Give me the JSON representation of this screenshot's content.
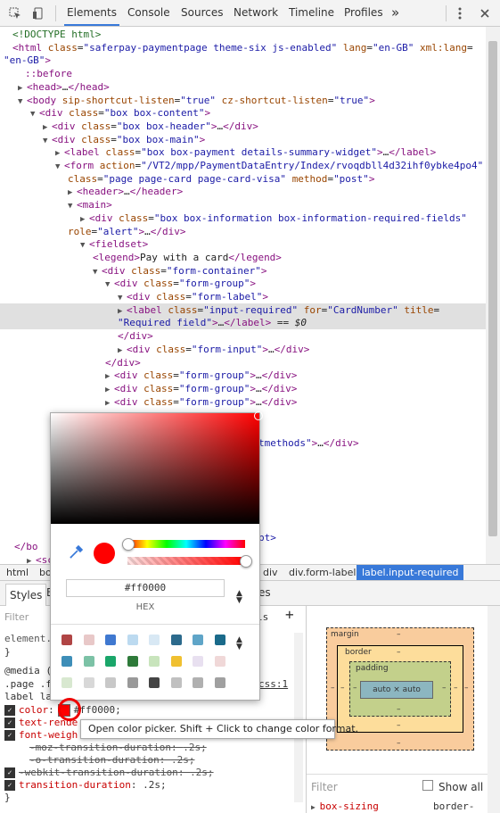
{
  "toolbar": {
    "tabs": [
      "Elements",
      "Console",
      "Sources",
      "Network",
      "Timeline",
      "Profiles"
    ],
    "more_label": "»"
  },
  "dom": [
    {
      "html": "<span class='cmt'>&lt;!DOCTYPE html&gt;</span>"
    },
    {
      "html": "<span class='tag'>&lt;html</span> <span class='attr'>class</span>=<span class='val'>\"saferpay-paymentpage theme-six js-enabled\"</span> <span class='attr'>lang</span>=<span class='val'>\"en-GB\"</span> <span class='attr'>xml:lang</span>="
    },
    {
      "html": "<span class='val'>\"en-GB\"</span><span class='tag'>&gt;</span>"
    },
    {
      "html": "<span class='pseudo'>::before</span>"
    },
    {
      "html": "<span class='tri'>▶</span><span class='tag'>&lt;head&gt;</span>…<span class='tag'>&lt;/head&gt;</span>"
    },
    {
      "html": "<span class='tri'>▼</span><span class='tag'>&lt;body</span> <span class='attr'>sip-shortcut-listen</span>=<span class='val'>\"true\"</span> <span class='attr'>cz-shortcut-listen</span>=<span class='val'>\"true\"</span><span class='tag'>&gt;</span>"
    },
    {
      "html": "<span class='tri'>▼</span><span class='tag'>&lt;div</span> <span class='attr'>class</span>=<span class='val'>\"box box-content\"</span><span class='tag'>&gt;</span>"
    },
    {
      "html": "<span class='tri'>▶</span><span class='tag'>&lt;div</span> <span class='attr'>class</span>=<span class='val'>\"box box-header\"</span><span class='tag'>&gt;</span>…<span class='tag'>&lt;/div&gt;</span>"
    },
    {
      "html": "<span class='tri'>▼</span><span class='tag'>&lt;div</span> <span class='attr'>class</span>=<span class='val'>\"box box-main\"</span><span class='tag'>&gt;</span>"
    },
    {
      "html": "<span class='tri'>▶</span><span class='tag'>&lt;label</span> <span class='attr'>class</span>=<span class='val'>\"box box-payment details-summary-widget\"</span><span class='tag'>&gt;</span>…<span class='tag'>&lt;/label&gt;</span>"
    },
    {
      "html": "<span class='tri'>▼</span><span class='tag'>&lt;form</span> <span class='attr'>action</span>=<span class='val'>\"/VT2/mpp/PaymentDataEntry/Index/rvoqdbll4d32ihf0ybke4po4\"</span>"
    },
    {
      "html": "<span class='attr'>class</span>=<span class='val'>\"page page-card page-card-visa\"</span> <span class='attr'>method</span>=<span class='val'>\"post\"</span><span class='tag'>&gt;</span>"
    },
    {
      "html": "<span class='tri'>▶</span><span class='tag'>&lt;header&gt;</span>…<span class='tag'>&lt;/header&gt;</span>"
    },
    {
      "html": "<span class='tri'>▼</span><span class='tag'>&lt;main&gt;</span>"
    },
    {
      "html": "<span class='tri'>▶</span><span class='tag'>&lt;div</span> <span class='attr'>class</span>=<span class='val'>\"box box-information box-information-required-fields\"</span>"
    },
    {
      "html": "<span class='attr'>role</span>=<span class='val'>\"alert\"</span><span class='tag'>&gt;</span>…<span class='tag'>&lt;/div&gt;</span>"
    },
    {
      "html": "<span class='tri'>▼</span><span class='tag'>&lt;fieldset&gt;</span>"
    },
    {
      "html": "<span class='tag'>&lt;legend&gt;</span>Pay with a card<span class='tag'>&lt;/legend&gt;</span>"
    },
    {
      "html": "<span class='tri'>▼</span><span class='tag'>&lt;div</span> <span class='attr'>class</span>=<span class='val'>\"form-container\"</span><span class='tag'>&gt;</span>"
    },
    {
      "html": "<span class='tri'>▼</span><span class='tag'>&lt;div</span> <span class='attr'>class</span>=<span class='val'>\"form-group\"</span><span class='tag'>&gt;</span>"
    },
    {
      "html": "<span class='tri'>▼</span><span class='tag'>&lt;div</span> <span class='attr'>class</span>=<span class='val'>\"form-label\"</span><span class='tag'>&gt;</span>"
    },
    {
      "html": "<span class='tri'>▶</span><span class='tag'>&lt;label</span> <span class='attr'>class</span>=<span class='val'>\"input-required\"</span> <span class='attr'>for</span>=<span class='val'>\"CardNumber\"</span> <span class='attr'>title</span>="
    },
    {
      "html": "<span class='val'>\"Required field\"</span><span class='tag'>&gt;</span>…<span class='tag'>&lt;/label&gt;</span> == <i>$0</i>"
    },
    {
      "html": "<span class='tag'>&lt;/div&gt;</span>"
    },
    {
      "html": "<span class='tri'>▶</span><span class='tag'>&lt;div</span> <span class='attr'>class</span>=<span class='val'>\"form-input\"</span><span class='tag'>&gt;</span>…<span class='tag'>&lt;/div&gt;</span>"
    },
    {
      "html": "<span class='tag'>&lt;/div&gt;</span>"
    },
    {
      "html": "<span class='tri'>▶</span><span class='tag'>&lt;div</span> <span class='attr'>class</span>=<span class='val'>\"form-group\"</span><span class='tag'>&gt;</span>…<span class='tag'>&lt;/div&gt;</span>"
    },
    {
      "html": "<span class='tri'>▶</span><span class='tag'>&lt;div</span> <span class='attr'>class</span>=<span class='val'>\"form-group\"</span><span class='tag'>&gt;</span>…<span class='tag'>&lt;/div&gt;</span>"
    },
    {
      "html": "<span class='tri'>▶</span><span class='tag'>&lt;div</span> <span class='attr'>class</span>=<span class='val'>\"form-group\"</span><span class='tag'>&gt;</span>…<span class='tag'>&lt;/div&gt;</span>"
    }
  ],
  "dom_partial": [
    {
      "html": "<span class='val'>tmethods\"</span><span class='tag'>&gt;</span>…<span class='tag'>&lt;/div&gt;</span>"
    },
    {
      "html": "<span class='val'>pt&gt;</span>"
    }
  ],
  "breadcrumbs": [
    "html",
    "bo",
    "div",
    "div.form-label",
    "label.input-required"
  ],
  "styles_tabs": [
    "Styles",
    "E"
  ],
  "styles_tab_partial": "es",
  "styles_filter_placeholder": "Filter",
  "styles_filter_suffix": "ls",
  "styles_lines": [
    {
      "text": "element.",
      "cls": ""
    },
    {
      "text": "}",
      "cls": ""
    },
    {
      "text": "@media (",
      "cls": ""
    },
    {
      "text": ".page .f",
      "cls": ""
    },
    {
      "text": "label la",
      "cls": ""
    }
  ],
  "css_link": "css:1",
  "decls": {
    "color_prop": "color",
    "color_value": "#ff0000;",
    "text_prop": "text-rende",
    "font_prop": "font-weigh",
    "moz_prop": "-moz-transition-duration",
    "moz_val": ".2s;",
    "o_prop": "-o-transition-duration",
    "o_val": ".2s;",
    "webkit_prop": "-webkit-transition-duration",
    "webkit_val": ".2s;",
    "td_prop": "transition-duration",
    "td_val": ".2s;",
    "close": "}"
  },
  "picker": {
    "hex_value": "#ff0000",
    "format_label": "HEX",
    "palette": [
      "#b04545",
      "#e8c8c8",
      "#3f78d0",
      "#bcdaf0",
      "#d8e8f4",
      "#2c6a8c",
      "#5fa5c8",
      "#1a6a8a",
      "#3e8eb8",
      "#7cc2a6",
      "#1aa66a",
      "#2e7a3a",
      "#c8e4bc",
      "#f0c030",
      "#e8e0f0",
      "#f0d8d8",
      "#d8e8d0",
      "#d8d8d8",
      "#c8c8c8",
      "#999999",
      "#444444",
      "#c0c0c0",
      "#b0b0b0",
      "#a0a0a0"
    ]
  },
  "tooltip": "Open color picker. Shift + Click to change color format.",
  "boxmodel": {
    "margin": "margin",
    "border": "border",
    "padding": "padding",
    "content": "auto × auto",
    "dash": "–",
    "colors": {
      "margin": "#f9cc9d",
      "border": "#fddd9b",
      "padding": "#c3d08b",
      "content": "#8cb6c0"
    }
  },
  "computed": {
    "filter_placeholder": "Filter",
    "show_all": "Show all",
    "first_prop": "box-sizing",
    "first_val": "border-"
  }
}
